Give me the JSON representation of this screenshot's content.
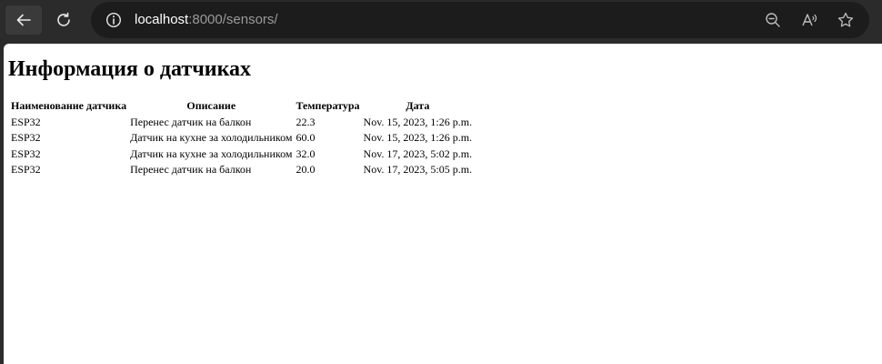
{
  "browser": {
    "url_host": "localhost",
    "url_rest": ":8000/sensors/",
    "icons": {
      "back": "arrow-left-icon",
      "reload": "reload-icon",
      "site_info": "info-icon",
      "zoom": "zoom-out-icon",
      "read_aloud": "read-aloud-icon",
      "favorite": "star-icon"
    }
  },
  "page": {
    "title": "Информация о датчиках",
    "table": {
      "headers": [
        "Наименование датчика",
        "Описание",
        "Температура",
        "Дата"
      ],
      "rows": [
        [
          "ESP32",
          "Перенес датчик на балкон",
          "22.3",
          "Nov. 15, 2023, 1:26 p.m."
        ],
        [
          "ESP32",
          "Датчик на кухне за холодильником",
          "60.0",
          "Nov. 15, 2023, 1:26 p.m."
        ],
        [
          "ESP32",
          "Датчик на кухне за холодильником",
          "32.0",
          "Nov. 17, 2023, 5:02 p.m."
        ],
        [
          "ESP32",
          "Перенес датчик на балкон",
          "20.0",
          "Nov. 17, 2023, 5:05 p.m."
        ]
      ]
    }
  }
}
